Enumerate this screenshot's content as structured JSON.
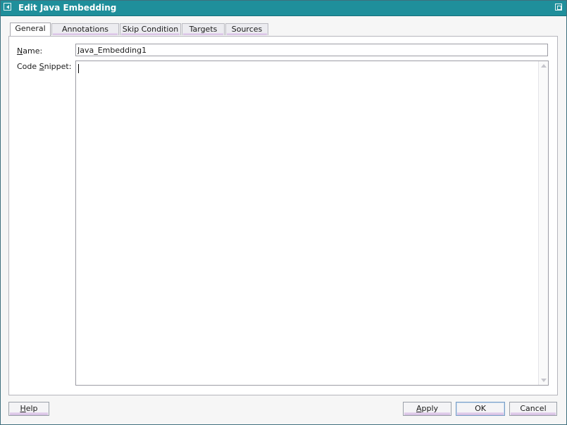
{
  "window": {
    "title": "Edit Java Embedding"
  },
  "tabs": [
    {
      "label": "General",
      "active": true
    },
    {
      "label": "Annotations",
      "active": false
    },
    {
      "label": "Skip Condition",
      "active": false
    },
    {
      "label": "Targets",
      "active": false
    },
    {
      "label": "Sources",
      "active": false
    }
  ],
  "form": {
    "name_label_mn": "N",
    "name_label_rest": "ame:",
    "name_value": "Java_Embedding1",
    "code_label_pre": "Code ",
    "code_label_mn": "S",
    "code_label_rest": "nippet:",
    "code_value": ""
  },
  "buttons": {
    "help_mn": "H",
    "help_rest": "elp",
    "apply_mn": "A",
    "apply_rest": "pply",
    "ok": "OK",
    "cancel": "Cancel"
  },
  "colors": {
    "titlebar": "#1f8f9b",
    "tab_accent": "#d4bde2",
    "default_button_border": "#7a9ec6"
  },
  "icons": [
    "window-menu-icon",
    "maximize-icon",
    "scroll-up-arrow-icon",
    "scroll-down-arrow-icon"
  ]
}
